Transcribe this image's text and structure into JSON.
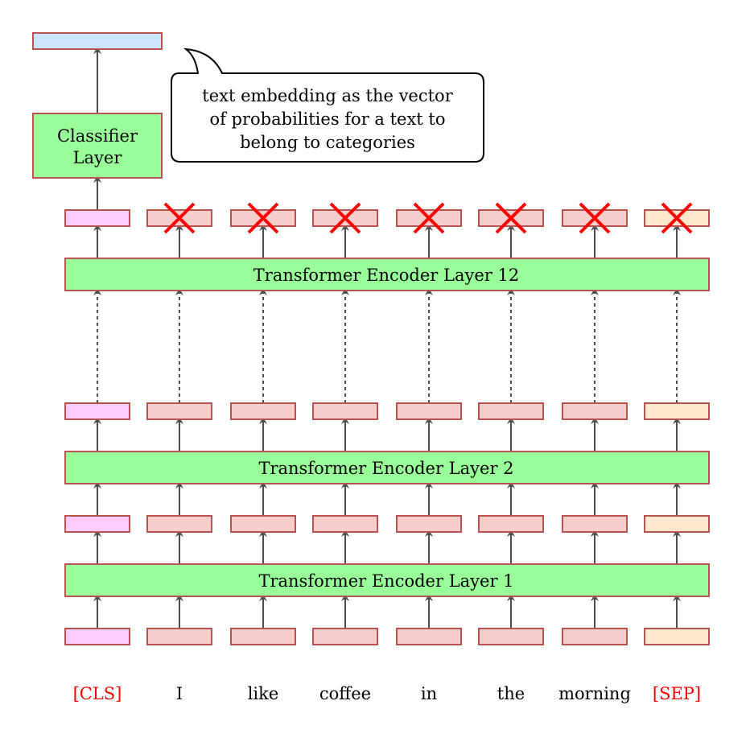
{
  "colors": {
    "border": "#b85450",
    "encoder_fill": "#99ff99",
    "token_fill": "#f8cecc",
    "cls_fill": "#ffccff",
    "sep_fill": "#ffe6cc",
    "output_fill": "#cce5ff",
    "arrow": "#4d4d4d",
    "cross": "#ff0000",
    "special_token_text": "#ff0000",
    "token_text": "#000000"
  },
  "output_vector": {
    "label": ""
  },
  "classifier": {
    "line1": "Classifier",
    "line2": "Layer"
  },
  "callout": {
    "line1": "text embedding as the vector",
    "line2": "of probabilities for a text to",
    "line3": "belong to categories"
  },
  "encoders": [
    {
      "label": "Transformer Encoder Layer 12"
    },
    {
      "label": "Transformer Encoder Layer 2"
    },
    {
      "label": "Transformer Encoder Layer 1"
    }
  ],
  "tokens": [
    {
      "text": "[CLS]",
      "type": "cls",
      "discarded_at_top": false
    },
    {
      "text": "I",
      "type": "word",
      "discarded_at_top": true
    },
    {
      "text": "like",
      "type": "word",
      "discarded_at_top": true
    },
    {
      "text": "coffee",
      "type": "word",
      "discarded_at_top": true
    },
    {
      "text": "in",
      "type": "word",
      "discarded_at_top": true
    },
    {
      "text": "the",
      "type": "word",
      "discarded_at_top": true
    },
    {
      "text": "morning",
      "type": "word",
      "discarded_at_top": true
    },
    {
      "text": "[SEP]",
      "type": "sep",
      "discarded_at_top": true
    }
  ]
}
